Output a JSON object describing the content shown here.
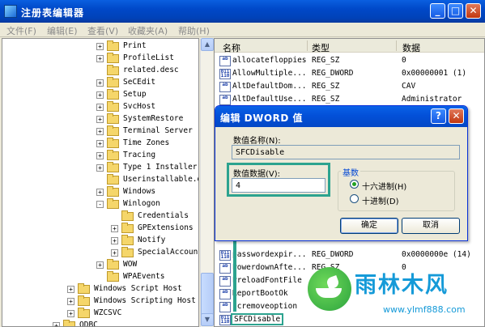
{
  "window": {
    "title": "注册表编辑器",
    "minimize": "_",
    "maximize": "□",
    "close": "✕"
  },
  "menu": [
    "文件(F)",
    "编辑(E)",
    "查看(V)",
    "收藏夹(A)",
    "帮助(H)"
  ],
  "tree": [
    {
      "label": "Print",
      "expander": "+",
      "indent": 1
    },
    {
      "label": "ProfileList",
      "expander": "+",
      "indent": 1
    },
    {
      "label": "related.desc",
      "expander": "",
      "indent": 1
    },
    {
      "label": "SeCEdit",
      "expander": "+",
      "indent": 1
    },
    {
      "label": "Setup",
      "expander": "+",
      "indent": 1
    },
    {
      "label": "SvcHost",
      "expander": "+",
      "indent": 1
    },
    {
      "label": "SystemRestore",
      "expander": "+",
      "indent": 1
    },
    {
      "label": "Terminal Server",
      "expander": "+",
      "indent": 1
    },
    {
      "label": "Time Zones",
      "expander": "+",
      "indent": 1
    },
    {
      "label": "Tracing",
      "expander": "+",
      "indent": 1
    },
    {
      "label": "Type 1 Installer",
      "expander": "+",
      "indent": 1
    },
    {
      "label": "Userinstallable.d",
      "expander": "",
      "indent": 1
    },
    {
      "label": "Windows",
      "expander": "+",
      "indent": 1
    },
    {
      "label": "Winlogon",
      "expander": "-",
      "indent": 1
    },
    {
      "label": "Credentials",
      "expander": "",
      "indent": 2
    },
    {
      "label": "GPExtensions",
      "expander": "+",
      "indent": 2
    },
    {
      "label": "Notify",
      "expander": "+",
      "indent": 2
    },
    {
      "label": "SpecialAccoun",
      "expander": "+",
      "indent": 2
    },
    {
      "label": "WOW",
      "expander": "+",
      "indent": 1
    },
    {
      "label": "WPAEvents",
      "expander": "",
      "indent": 1
    },
    {
      "label": "Windows Script Host",
      "expander": "+",
      "indent": 0
    },
    {
      "label": "Windows Scripting Host",
      "expander": "+",
      "indent": 0
    },
    {
      "label": "WZCSVC",
      "expander": "+",
      "indent": 0
    },
    {
      "label": "ODBC",
      "expander": "+",
      "indent": -1
    }
  ],
  "list": {
    "headers": [
      "名称",
      "类型",
      "数据"
    ],
    "rows": [
      {
        "name": "allocatefloppies",
        "type": "REG_SZ",
        "data": "0",
        "icon": "ab"
      },
      {
        "name": "AllowMultiple...",
        "type": "REG_DWORD",
        "data": "0x00000001 (1)",
        "icon": "dw"
      },
      {
        "name": "AltDefaultDom...",
        "type": "REG_SZ",
        "data": "CAV",
        "icon": "ab"
      },
      {
        "name": "AltDefaultUse...",
        "type": "REG_SZ",
        "data": "Administrator",
        "icon": "ab"
      },
      {
        "name": "passwordexpir...",
        "type": "REG_DWORD",
        "data": "0x0000000e (14)",
        "icon": "dw"
      },
      {
        "name": "PowerdownAfte...",
        "type": "REG_SZ",
        "data": "0",
        "icon": "ab"
      },
      {
        "name": "PreloadFontFile",
        "type": "",
        "data": "",
        "icon": "ab"
      },
      {
        "name": "ReportBootOk",
        "type": "",
        "data": "",
        "icon": "ab"
      },
      {
        "name": "scremoveoption",
        "type": "",
        "data": "",
        "icon": "ab"
      },
      {
        "name": "SFCDisable",
        "type": "",
        "data": "",
        "icon": "dw",
        "selected": true
      }
    ]
  },
  "dialog": {
    "title": "编辑 DWORD 值",
    "help": "?",
    "close": "✕",
    "value_name_label": "数值名称(N):",
    "value_name": "SFCDisable",
    "value_data_label": "数值数据(V):",
    "value_data": "4",
    "base_label": "基数",
    "hex_label": "十六进制(H)",
    "dec_label": "十进制(D)",
    "ok": "确定",
    "cancel": "取消"
  },
  "watermark": {
    "brand": "雨林木风",
    "url": "www.ylmf888.com"
  },
  "colors": {
    "highlight": "#2ca38f",
    "titlebar": "#0350d8",
    "watermark": "#159ad8"
  }
}
